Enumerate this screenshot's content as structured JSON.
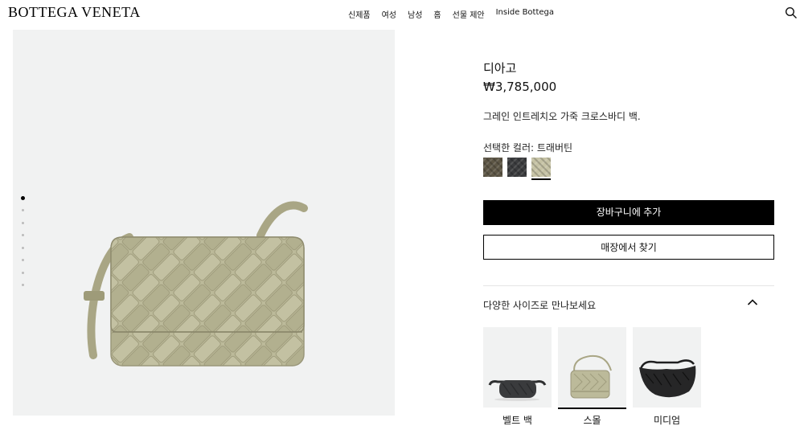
{
  "header": {
    "logo": "BOTTEGA VENETA",
    "nav": [
      "신제품",
      "여성",
      "남성",
      "홈",
      "선물 제안",
      "Inside Bottega"
    ]
  },
  "gallery": {
    "dot_count": 8,
    "active_index": 0
  },
  "product": {
    "name": "디아고",
    "price": "₩3,785,000",
    "description": "그레인 인트레치오 가죽 크로스바디 백.",
    "color_label": "선택한 컬러: 트래버틴",
    "swatches": [
      {
        "color": "#5d5645",
        "selected": false
      },
      {
        "color": "#3b3c3e",
        "selected": false
      },
      {
        "color": "#c5c2a4",
        "selected": true
      }
    ]
  },
  "actions": {
    "add_to_cart": "장바구니에 추가",
    "find_in_store": "매장에서 찾기"
  },
  "sizes": {
    "title": "다양한 사이즈로 만나보세요",
    "items": [
      {
        "label": "벨트 백",
        "selected": false
      },
      {
        "label": "스몰",
        "selected": true
      },
      {
        "label": "미디엄",
        "selected": false
      }
    ]
  },
  "colors": {
    "bag_travertine": "#b9b797",
    "bag_travertine_dark": "#a3a07f",
    "panel_bg": "#f1f2f2"
  }
}
